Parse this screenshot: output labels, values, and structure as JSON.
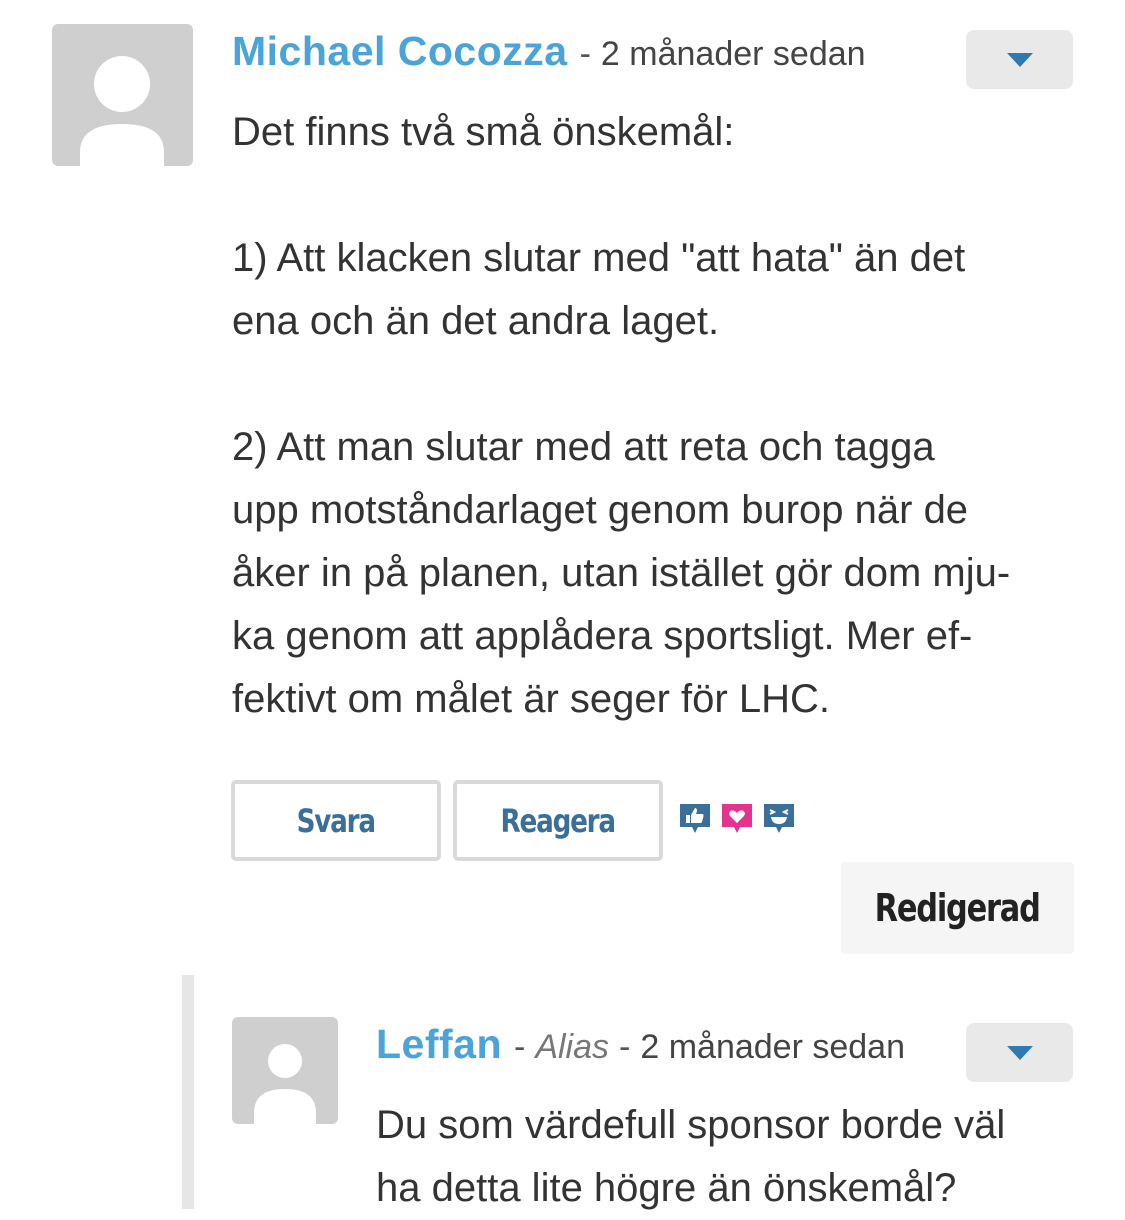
{
  "comments": [
    {
      "author": "Michael Cocozza",
      "separator": "-",
      "time": "2 månader sedan",
      "paragraphs": [
        [
          "Det finns två små önskemål:"
        ],
        [
          "1) Att klacken slutar med \"att hata\" än det",
          "ena och än det andra laget."
        ],
        [
          "2) Att man slutar med att reta och tagga",
          "upp motståndarlaget genom burop när de",
          "åker in på planen, utan istället gör dom mju-",
          "ka genom att applådera sportsligt. Mer ef-",
          "fektivt om målet är seger för LHC."
        ]
      ],
      "actions": {
        "reply_label": "Svara",
        "react_label": "Reagera"
      },
      "reactions": [
        {
          "icon": "thumbs-up-icon",
          "color": "#3a6f99"
        },
        {
          "icon": "heart-icon",
          "color": "#e2338f"
        },
        {
          "icon": "laugh-icon",
          "color": "#3a6f99"
        }
      ],
      "edited_label": "Redigerad",
      "menu_icon": "chevron-down-icon"
    },
    {
      "author": "Leffan",
      "separator": "-",
      "alias": "Alias",
      "separator2": "-",
      "time": "2 månader sedan",
      "lines": [
        "Du som värdefull sponsor borde väl",
        "ha detta lite högre än önskemål?"
      ],
      "menu_icon": "chevron-down-icon"
    }
  ],
  "colors": {
    "author": "#4aa3d9",
    "button_text": "#3a6f99",
    "menu_arrow": "#2f7ab3",
    "avatar_bg": "#cfcfcf"
  }
}
